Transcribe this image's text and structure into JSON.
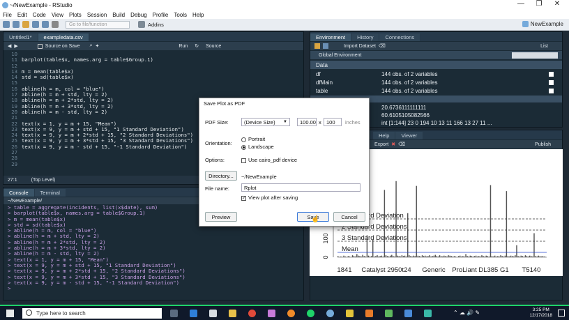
{
  "window": {
    "title": "~/NewExample - RStudio",
    "minimize": "—",
    "maximize": "❐",
    "close": "✕"
  },
  "menu": [
    "File",
    "Edit",
    "Code",
    "View",
    "Plots",
    "Session",
    "Build",
    "Debug",
    "Profile",
    "Tools",
    "Help"
  ],
  "toolbar": {
    "goto_placeholder": "Go to file/function",
    "addins": "Addins",
    "project": "NewExample"
  },
  "editor": {
    "tabs": [
      "Untitled1*",
      "exampledata.csv"
    ],
    "source_on_save": "Source on Save",
    "run": "Run",
    "source": "Source",
    "lines": [
      {
        "n": "10",
        "t": ""
      },
      {
        "n": "11",
        "t": "barplot(table$x, names.arg = table$Group.1)"
      },
      {
        "n": "12",
        "t": ""
      },
      {
        "n": "13",
        "t": "m = mean(table$x)"
      },
      {
        "n": "14",
        "t": "std = sd(table$x)"
      },
      {
        "n": "15",
        "t": ""
      },
      {
        "n": "16",
        "t": "abline(h = m, col = \"blue\")"
      },
      {
        "n": "17",
        "t": "abline(h = m + std, lty = 2)"
      },
      {
        "n": "18",
        "t": "abline(h = m + 2*std, lty = 2)"
      },
      {
        "n": "19",
        "t": "abline(h = m + 3*std, lty = 2)"
      },
      {
        "n": "20",
        "t": "abline(h = m - std, lty = 2)"
      },
      {
        "n": "21",
        "t": ""
      },
      {
        "n": "22",
        "t": "text(x = 1, y = m + 15, \"Mean\")"
      },
      {
        "n": "23",
        "t": "text(x = 9, y = m + std + 15, \"1 Standard Deviation\")"
      },
      {
        "n": "24",
        "t": "text(x = 9, y = m + 2*std + 15, \"2 Standard Deviations\")"
      },
      {
        "n": "25",
        "t": "text(x = 9, y = m + 3*std + 15, \"3 Standard Deviations\")"
      },
      {
        "n": "26",
        "t": "text(x = 9, y = m - std + 15, \"-1 Standard Deviation\")"
      },
      {
        "n": "27",
        "t": ""
      },
      {
        "n": "28",
        "t": ""
      },
      {
        "n": "29",
        "t": ""
      }
    ],
    "status_pos": "27:1",
    "status_scope": "(Top Level)"
  },
  "console": {
    "tabs": [
      "Console",
      "Terminal"
    ],
    "path": "~/NewExample/",
    "lines": [
      "> table = aggregate(incidents, list(x$date), sum)",
      "> barplot(table$x, names.arg = table$Group.1)",
      "> m = mean(table$x)",
      "> std = sd(table$x)",
      "> abline(h = m, col = \"blue\")",
      "> abline(h = m + std, lty = 2)",
      "> abline(h = m + 2*std, lty = 2)",
      "> abline(h = m + 3*std, lty = 2)",
      "> abline(h = m - std, lty = 2)",
      "> text(x = 1, y = m + 15, \"Mean\")",
      "> text(x = 9, y = m + std + 15, \"1 Standard Deviation\")",
      "> text(x = 9, y = m + 2*std + 15, \"2 Standard Deviations\")",
      "> text(x = 9, y = m + 3*std + 15, \"3 Standard Deviations\")",
      "> text(x = 9, y = m - std + 15, \"-1 Standard Deviation\")",
      ">"
    ]
  },
  "env": {
    "tabs": [
      "Environment",
      "History",
      "Connections"
    ],
    "import": "Import Dataset",
    "list": "List",
    "global": "Global Environment",
    "section": "Data",
    "rows": [
      {
        "name": "df",
        "value": "144 obs. of 2 variables"
      },
      {
        "name": "dfMain",
        "value": "144 obs. of 2 variables"
      },
      {
        "name": "table",
        "value": "144 obs. of 2 variables"
      }
    ],
    "values": [
      "20.6736111111111",
      "60.6105105082566",
      "int [1:144] 23 0 194 10 13 11 166 13 27 11 ..."
    ]
  },
  "plots": {
    "tabs": [
      "Help",
      "Viewer"
    ],
    "export": "Export",
    "publish": "Publish"
  },
  "chart_data": {
    "type": "bar",
    "categories": [
      "1841",
      "Catalyst 2950t24",
      "Generic",
      "ProLiant DL385 G1",
      "T5140"
    ],
    "ylabel_ticks": [
      "0",
      "100"
    ],
    "annotations": [
      "Mean",
      "1 Standard Deviation",
      "2 Standard Deviations",
      "3 Standard Deviations"
    ],
    "bar_values": [
      3,
      1,
      2,
      1,
      4,
      2,
      1,
      3,
      2,
      1,
      5,
      3,
      2,
      8,
      4,
      3,
      2,
      6,
      3,
      2,
      55,
      4,
      2,
      3,
      44,
      2,
      3,
      5,
      2,
      3,
      4,
      2,
      168,
      5,
      3,
      2,
      4,
      6,
      3,
      2,
      190,
      4,
      3,
      2,
      5,
      3,
      4,
      2,
      110,
      5,
      3,
      2,
      4,
      3,
      178,
      4,
      3,
      2,
      5,
      3,
      4,
      2,
      3,
      5,
      2,
      3,
      4,
      6,
      3,
      2,
      5,
      3,
      2,
      4,
      3,
      2,
      5,
      4,
      3,
      2,
      3,
      2,
      1,
      3,
      4,
      2,
      3,
      2,
      8,
      3,
      2,
      4,
      3,
      2,
      3,
      4,
      2,
      3,
      2,
      5,
      3,
      2,
      4,
      3,
      2,
      180,
      3,
      2,
      4,
      2,
      3,
      2,
      5,
      3,
      2,
      4,
      165,
      3,
      2,
      4,
      3,
      2,
      5,
      30,
      3,
      2,
      4,
      3,
      2,
      5,
      3,
      2,
      4,
      3,
      2,
      60,
      3,
      2,
      4,
      3,
      2,
      3,
      2,
      1
    ]
  },
  "dialog": {
    "title": "Save Plot as PDF",
    "pdf_size_label": "PDF Size:",
    "pdf_size_value": "(Device Size)",
    "width": "100.00",
    "height": "100",
    "units": "inches",
    "times": "x",
    "orientation_label": "Orientation:",
    "portrait": "Portrait",
    "landscape": "Landscape",
    "options_label": "Options:",
    "cairo": "Use cairo_pdf device",
    "directory_btn": "Directory...",
    "directory_value": "~/NewExample",
    "filename_label": "File name:",
    "filename_value": "Rplot",
    "view_after": "View plot after saving",
    "preview": "Preview",
    "save": "Save",
    "cancel": "Cancel"
  },
  "taskbar": {
    "search": "Type here to search",
    "time": "3:25 PM",
    "date": "12/17/2018"
  }
}
